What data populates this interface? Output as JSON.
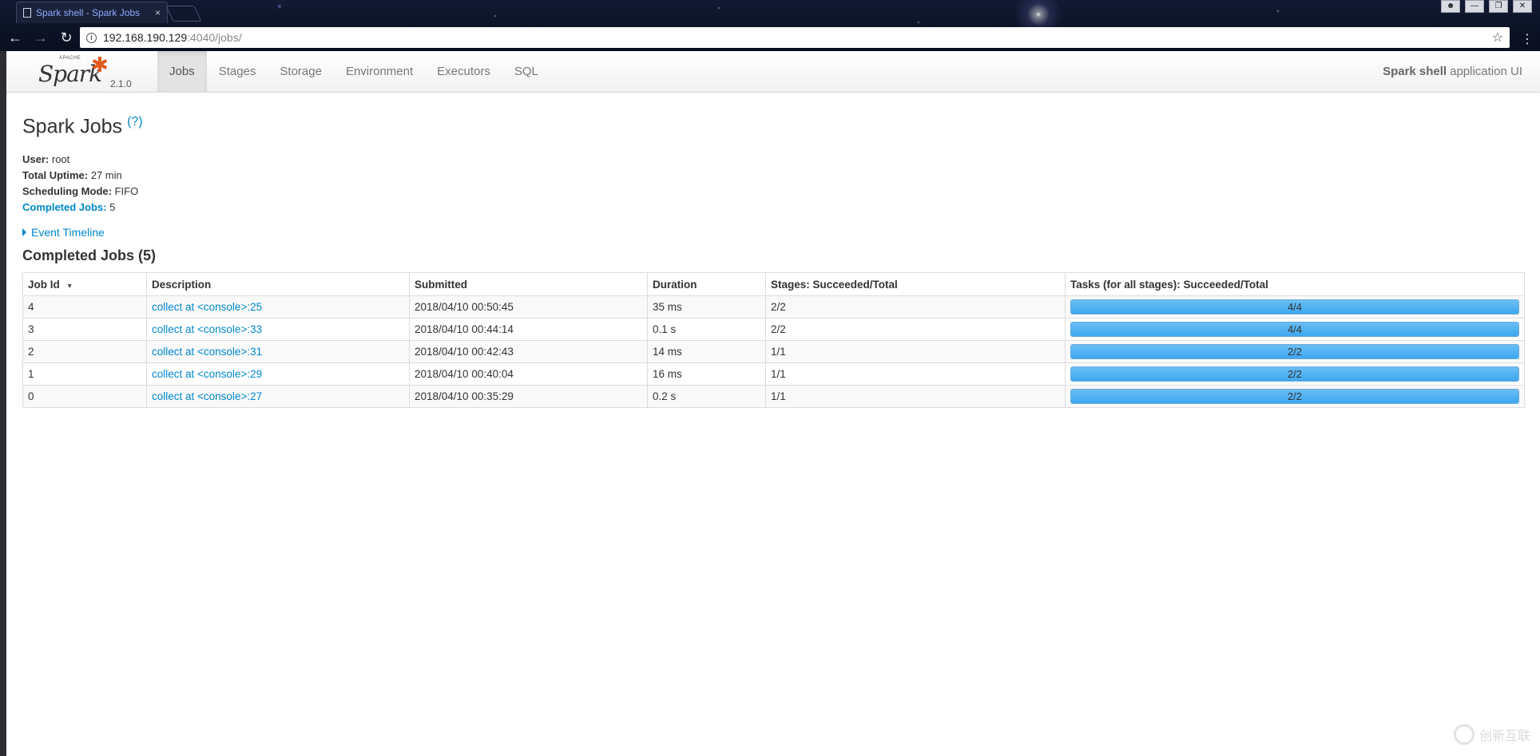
{
  "browser": {
    "tab_title": "Spark shell - Spark Jobs",
    "tab_close": "×",
    "url_host": "192.168.190.129",
    "url_rest": ":4040/jobs/"
  },
  "navbar": {
    "brand_small": "APACHE",
    "brand_name": "Spark",
    "version": "2.1.0",
    "tabs": [
      "Jobs",
      "Stages",
      "Storage",
      "Environment",
      "Executors",
      "SQL"
    ],
    "active_tab": "Jobs",
    "app_name": "Spark shell",
    "app_suffix": "application UI"
  },
  "page": {
    "title": "Spark Jobs",
    "help": "(?)",
    "summary": {
      "user_label": "User:",
      "user": "root",
      "uptime_label": "Total Uptime:",
      "uptime": "27 min",
      "mode_label": "Scheduling Mode:",
      "mode": "FIFO",
      "completed_label": "Completed Jobs:",
      "completed": "5"
    },
    "event_timeline": "Event Timeline",
    "section_title": "Completed Jobs (5)"
  },
  "table": {
    "headers": [
      "Job Id",
      "Description",
      "Submitted",
      "Duration",
      "Stages: Succeeded/Total",
      "Tasks (for all stages): Succeeded/Total"
    ],
    "rows": [
      {
        "id": "4",
        "description": "collect at <console>:25",
        "submitted": "2018/04/10 00:50:45",
        "duration": "35 ms",
        "stages": "2/2",
        "tasks": "4/4",
        "progress": 1.0
      },
      {
        "id": "3",
        "description": "collect at <console>:33",
        "submitted": "2018/04/10 00:44:14",
        "duration": "0.1 s",
        "stages": "2/2",
        "tasks": "4/4",
        "progress": 1.0
      },
      {
        "id": "2",
        "description": "collect at <console>:31",
        "submitted": "2018/04/10 00:42:43",
        "duration": "14 ms",
        "stages": "1/1",
        "tasks": "2/2",
        "progress": 1.0
      },
      {
        "id": "1",
        "description": "collect at <console>:29",
        "submitted": "2018/04/10 00:40:04",
        "duration": "16 ms",
        "stages": "1/1",
        "tasks": "2/2",
        "progress": 1.0
      },
      {
        "id": "0",
        "description": "collect at <console>:27",
        "submitted": "2018/04/10 00:35:29",
        "duration": "0.2 s",
        "stages": "1/1",
        "tasks": "2/2",
        "progress": 1.0
      }
    ]
  },
  "watermark": "创新互联",
  "colors": {
    "link": "#0088cc",
    "progress_fill": "#3ea7ef",
    "spark_orange": "#e25a1c"
  }
}
